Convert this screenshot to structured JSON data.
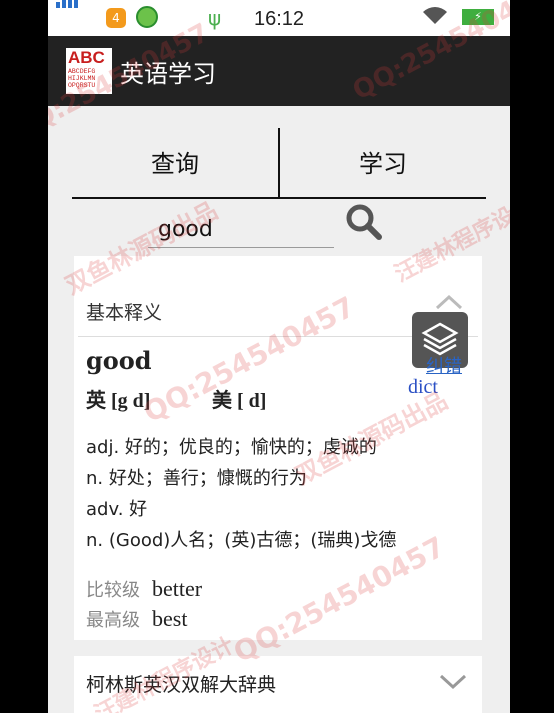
{
  "status_bar": {
    "badge": "4",
    "time": "16:12"
  },
  "app_bar": {
    "logo_big": "ABC",
    "logo_small": "ABCDEFG\nHIJKLMN\nOPQRSTU",
    "title": "英语学习"
  },
  "tabs": [
    {
      "label": "查询"
    },
    {
      "label": "学习"
    }
  ],
  "search": {
    "value": "good",
    "icon": "search-icon"
  },
  "basic": {
    "title": "基本释义",
    "word": "good",
    "phonetic_uk": "英 [g d]",
    "phonetic_us": "美 [  d]",
    "definitions": [
      "adj. 好的；优良的；愉快的；虔诚的",
      "n. 好处；善行；慷慨的行为",
      "adv. 好",
      "n. (Good)人名；(英)古德；(瑞典)戈德"
    ],
    "forms": [
      {
        "label": "比较级",
        "value": "better"
      },
      {
        "label": "最高级",
        "value": "best"
      }
    ]
  },
  "floating": {
    "report_label": "纠错",
    "dict_label": "dict",
    "layers_icon": "layers-icon"
  },
  "collins": {
    "title": "柯林斯英汉双解大辞典"
  },
  "watermarks": [
    "QQ:254540457",
    "QQ:254540457",
    "QQ:254540457",
    "QQ:254540457",
    "双鱼林源码出品",
    "双鱼林源码出品",
    "汪建林程序设计",
    "汪建林程序设计"
  ],
  "colors": {
    "app_bar": "#222222",
    "background": "#efefef",
    "link": "#2a64c4",
    "watermark": "#dc3c3c"
  }
}
